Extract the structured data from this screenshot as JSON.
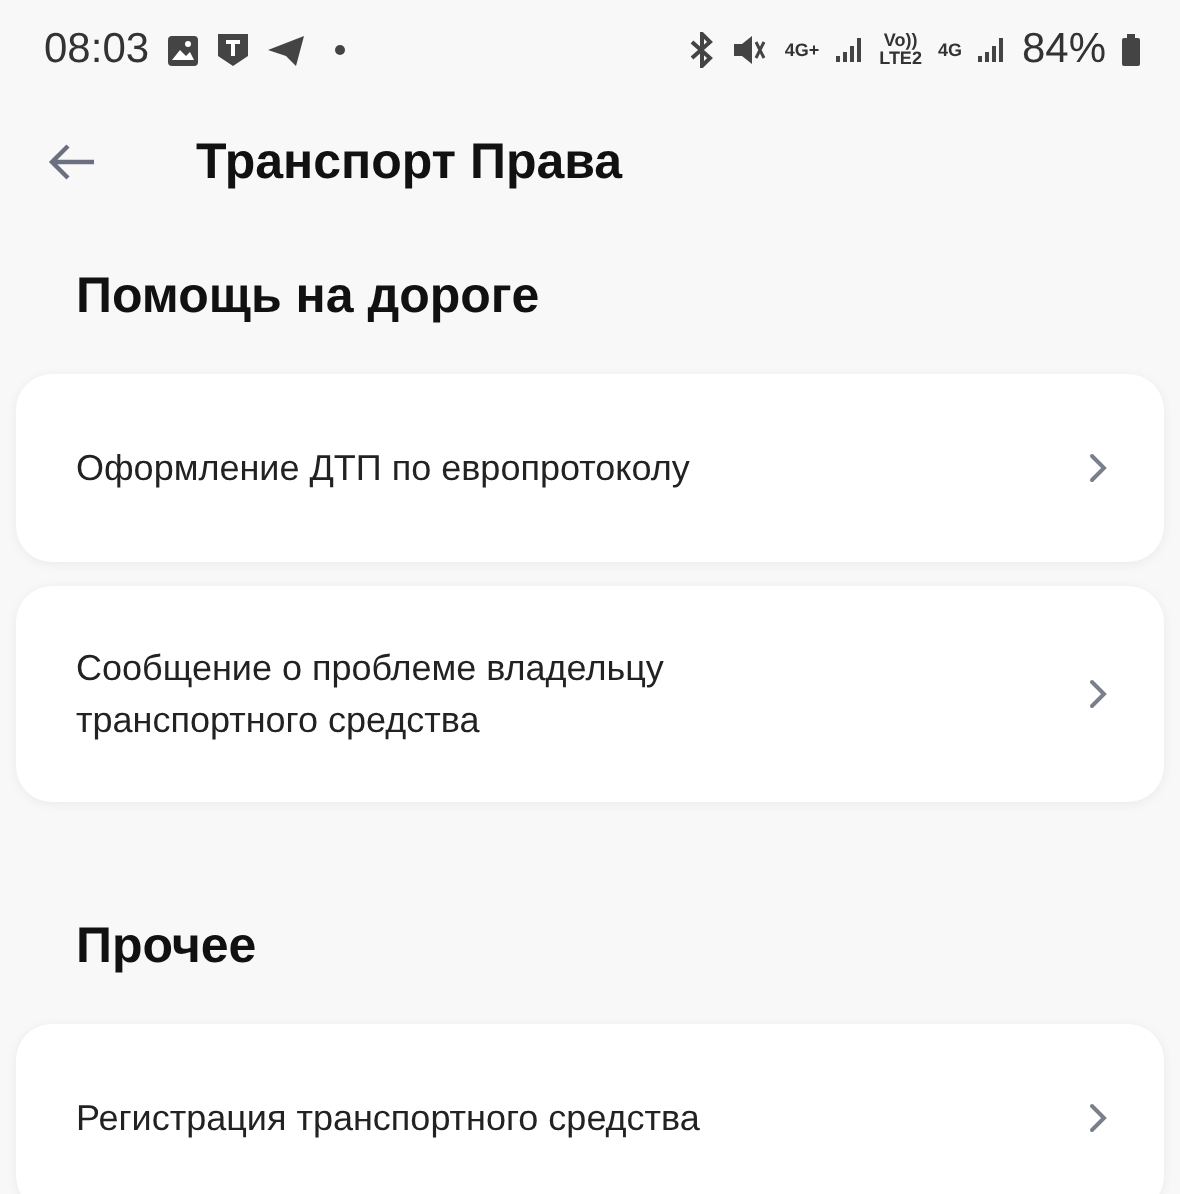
{
  "status_bar": {
    "time": "08:03",
    "network_1": "4G+",
    "volte": "Vo))",
    "lte": "LTE2",
    "network_2": "4G",
    "battery": "84%"
  },
  "header": {
    "title": "Транспорт Права"
  },
  "sections": [
    {
      "title": "Помощь на дороге",
      "items": [
        {
          "label": "Оформление ДТП по европротоколу"
        },
        {
          "label": "Сообщение о проблеме владельцу транспортного средства"
        }
      ]
    },
    {
      "title": "Прочее",
      "items": [
        {
          "label": "Регистрация транспортного средства"
        }
      ]
    }
  ]
}
